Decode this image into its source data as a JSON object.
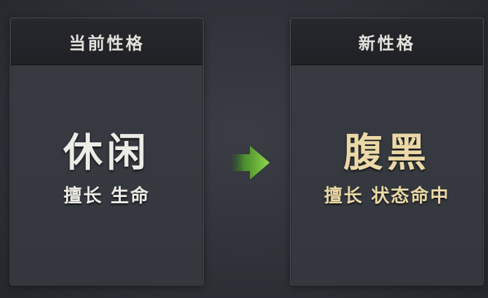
{
  "current": {
    "header": "当前性格",
    "trait": "休闲",
    "skill": "擅长 生命"
  },
  "new": {
    "header": "新性格",
    "trait": "腹黑",
    "skill": "擅长 状态命中"
  },
  "colors": {
    "current_text": "#ecebe6",
    "new_text": "#ead8a6",
    "arrow": "#6fc23a"
  },
  "icons": {
    "arrow": "arrow-right-icon"
  }
}
